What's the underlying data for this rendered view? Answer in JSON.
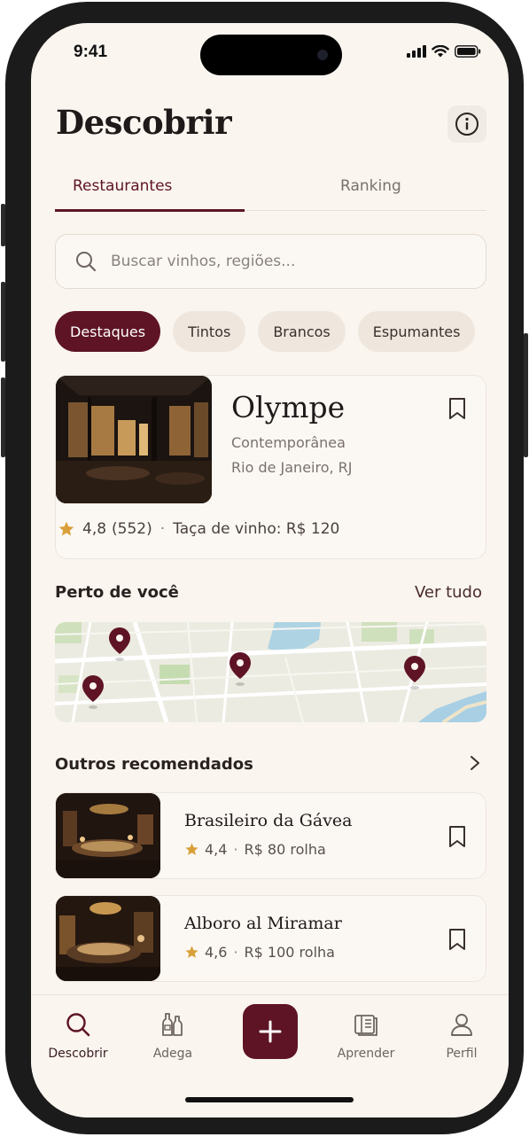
{
  "status": {
    "time": "9:41"
  },
  "header": {
    "title": "Descobrir"
  },
  "tabs": [
    {
      "label": "Restaurantes"
    },
    {
      "label": "Ranking"
    }
  ],
  "search": {
    "placeholder": "Buscar vinhos, regiões..."
  },
  "filters": [
    {
      "label": "Destaques",
      "active": true
    },
    {
      "label": "Tintos"
    },
    {
      "label": "Brancos"
    },
    {
      "label": "Espumantes"
    }
  ],
  "featured": {
    "name": "Olympe",
    "cuisine": "Contemporânea",
    "location": "Rio de Janeiro, RJ",
    "rating": "4,8",
    "reviews": "(552)",
    "separator": "·",
    "wine_glass": "Taça de vinho: R$ 120"
  },
  "nearby": {
    "title": "Perto de você",
    "see_all": "Ver tudo"
  },
  "recommended": {
    "title": "Outros recomendados",
    "items": [
      {
        "name": "Brasileiro da Gávea",
        "rating": "4,4",
        "separator": "·",
        "price": "R$ 80 rolha"
      },
      {
        "name": "Alboro al Miramar",
        "rating": "4,6",
        "separator": "·",
        "price": "R$ 100 rolha"
      }
    ]
  },
  "tabbar": {
    "items": [
      {
        "label": "Descobrir",
        "icon": "search-icon",
        "active": true
      },
      {
        "label": "Adega",
        "icon": "wine-bottles-icon"
      },
      {
        "label": "",
        "icon": "plus-icon"
      },
      {
        "label": "Aprender",
        "icon": "book-icon"
      },
      {
        "label": "Perfil",
        "icon": "person-icon"
      }
    ]
  },
  "colors": {
    "accent": "#5e1424",
    "background": "#faf5ef",
    "star": "#d9a03a"
  }
}
